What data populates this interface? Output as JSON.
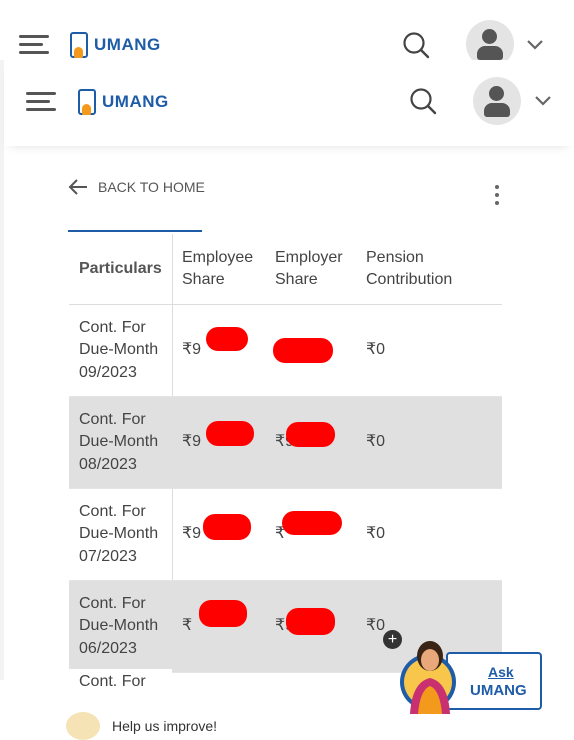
{
  "header": {
    "brand": "UMANG",
    "menu_icon": "hamburger-icon",
    "search_icon": "search-icon",
    "profile_icon": "user-icon",
    "dropdown_icon": "chevron-down-icon"
  },
  "nav": {
    "back_label": "BACK TO HOME",
    "more_icon": "kebab-icon"
  },
  "table": {
    "headers": [
      "Particulars",
      "Employee Share",
      "Employer Share",
      "Pension Contribution"
    ],
    "rows": [
      {
        "particulars": "Cont. For Due-Month 09/2023",
        "employee": "₹9",
        "employer": "",
        "pension": "₹0"
      },
      {
        "particulars": "Cont. For Due-Month 08/2023",
        "employee": "₹9",
        "employer": "₹9",
        "pension": "₹0"
      },
      {
        "particulars": "Cont. For Due-Month 07/2023",
        "employee": "₹9",
        "employer": "₹",
        "pension": "₹0"
      },
      {
        "particulars": "Cont. For Due-Month 06/2023",
        "employee": "₹",
        "employer": "₹9",
        "pension": "₹0"
      }
    ],
    "partial_row": "Cont. For"
  },
  "assistant": {
    "line1": "Ask",
    "line2": "UMANG",
    "plus": "+"
  },
  "feedback": {
    "text": "Help us improve!"
  },
  "colors": {
    "brand_blue": "#1f5ca8",
    "brand_orange": "#f39a1c",
    "redaction": "#ff0000",
    "row_shade": "#e0e0e0"
  }
}
